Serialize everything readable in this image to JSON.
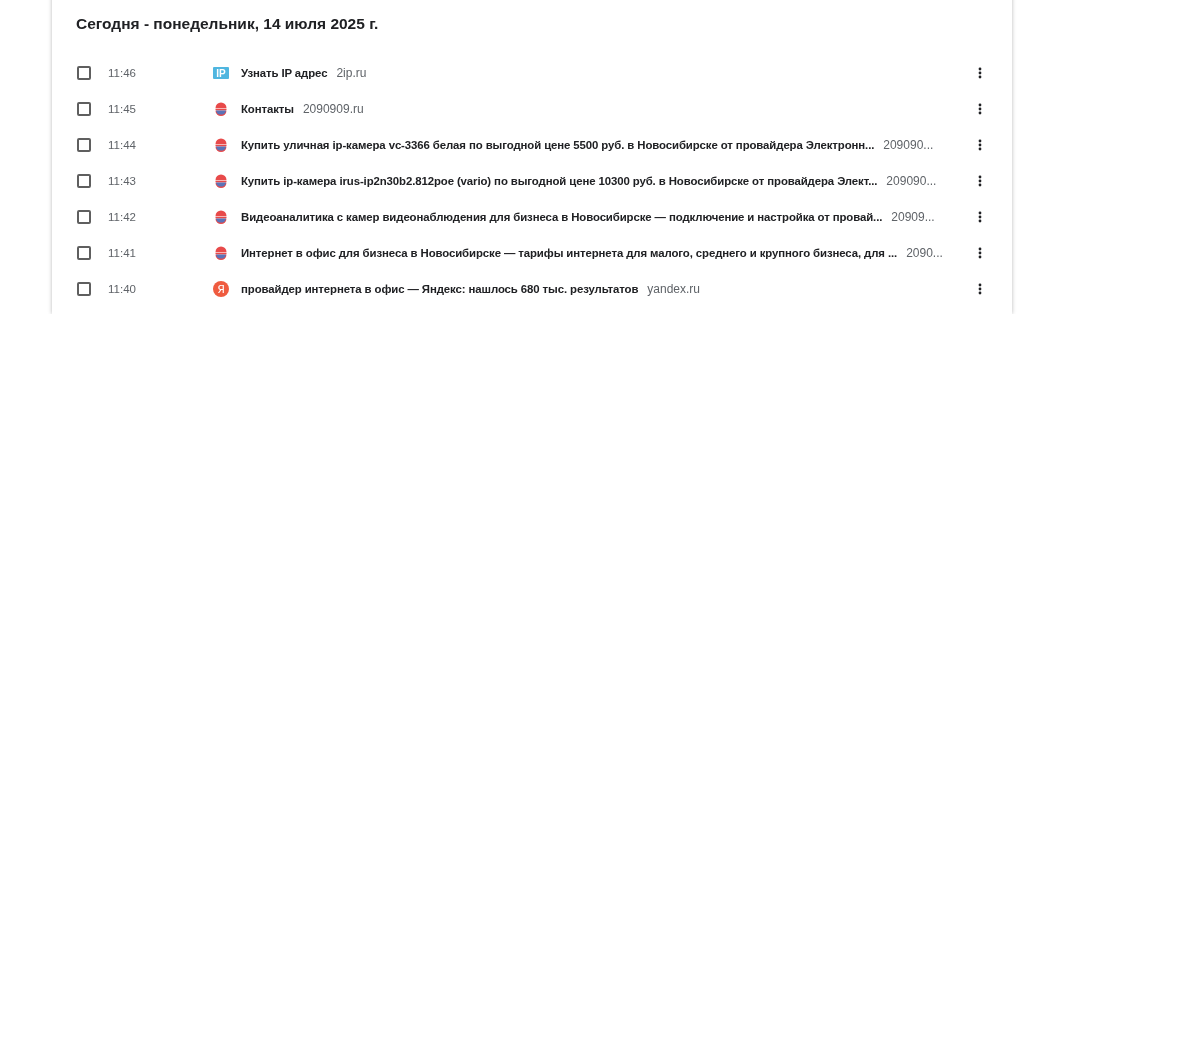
{
  "history": {
    "heading": "Сегодня - понедельник, 14 июля 2025 г.",
    "entries": [
      {
        "checked": false,
        "time": "11:46",
        "icon": {
          "kind": "badge",
          "text": "IP"
        },
        "title": "Узнать IP адрес",
        "domain": "2ip.ru"
      },
      {
        "checked": false,
        "time": "11:45",
        "icon": {
          "kind": "ball"
        },
        "title": "Контакты",
        "domain": "2090909.ru"
      },
      {
        "checked": false,
        "time": "11:44",
        "icon": {
          "kind": "ball"
        },
        "title": "Купить уличная ip-камера vc-3366 белая по выгодной цене 5500 руб. в Новосибирске от провайдера Электронн...",
        "domain": "209090..."
      },
      {
        "checked": false,
        "time": "11:43",
        "icon": {
          "kind": "ball"
        },
        "title": "Купить ip-камера irus-ip2n30b2.812poe (vario) по выгодной цене 10300 руб. в Новосибирске от провайдера Элект...",
        "domain": "209090..."
      },
      {
        "checked": false,
        "time": "11:42",
        "icon": {
          "kind": "ball"
        },
        "title": "Видеоаналитика с камер видеонаблюдения для бизнеса в Новосибирске — подключение и настройка от провай...",
        "domain": "20909..."
      },
      {
        "checked": false,
        "time": "11:41",
        "icon": {
          "kind": "ball"
        },
        "title": "Интернет в офис для бизнеса в Новосибирске — тарифы интернета для малого, среднего и крупного бизнеса, для ...",
        "domain": "2090..."
      },
      {
        "checked": false,
        "time": "11:40",
        "icon": {
          "kind": "circle",
          "text": "Я"
        },
        "title": "провайдер интернета в офис — Яндекс: нашлось 680 тыс. результатов",
        "domain": "yandex.ru"
      }
    ]
  }
}
